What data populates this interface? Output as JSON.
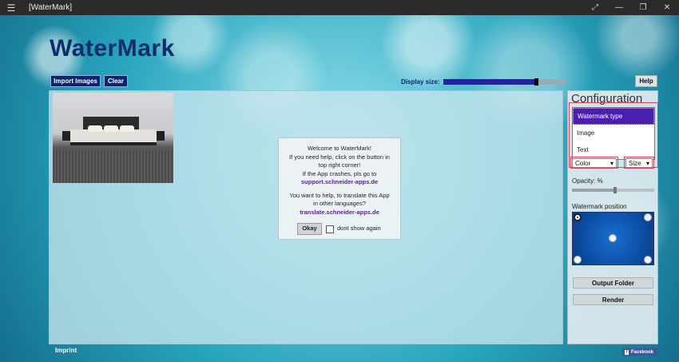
{
  "window": {
    "title": "[WaterMark]",
    "menu_icon": "hamburger-icon",
    "controls": [
      "expand-icon",
      "minimize-icon",
      "restore-icon",
      "close-icon"
    ],
    "expand_glyph": "⤢",
    "minimize_glyph": "—",
    "restore_glyph": "❐",
    "close_glyph": "✕"
  },
  "app": {
    "title": "WaterMark",
    "import_label": "Import Images",
    "clear_label": "Clear",
    "display_size_label": "Display size:",
    "display_size_fraction": 0.75,
    "help_label": "Help",
    "imprint_label": "Imprint",
    "facebook_label": "Facebook"
  },
  "welcome": {
    "line1": "Welcome to WaterMark!",
    "line2": "If you need help, click on the button in",
    "line3": "top right corner!",
    "line4": "If the App crashes, pls go to",
    "link1": "support.schneider-apps.de",
    "line5": "You want to help, to translate this App",
    "line6": "in other languages?",
    "link2": "translate.schneider-apps.de",
    "okay_label": "Okay",
    "dont_show_label": "dont show again",
    "dont_show_checked": false
  },
  "config": {
    "title": "Configuration",
    "type_options": [
      "Watermark type",
      "Image",
      "Text"
    ],
    "type_selected": "Watermark type",
    "color_label": "Color",
    "size_label": "Size",
    "opacity_label": "Opacity: %",
    "opacity_fraction": 0.5,
    "position_label": "Watermark position",
    "position_selected": "top-left",
    "output_folder_label": "Output Folder",
    "render_label": "Render"
  },
  "colors": {
    "accent": "#0b2572",
    "selected_item": "#4a1fae",
    "link": "#5a1e9a",
    "outline": "#d04560"
  }
}
